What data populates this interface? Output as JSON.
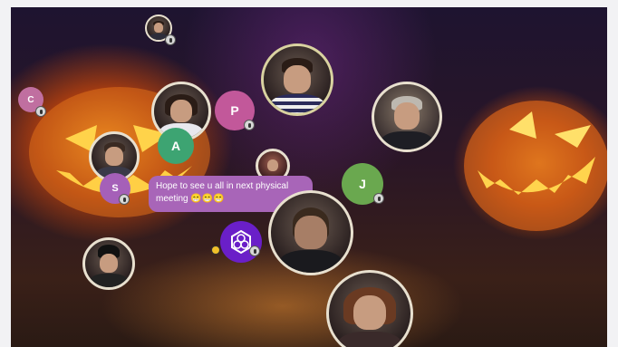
{
  "participants": [
    {
      "id": "p-top",
      "type": "video"
    },
    {
      "id": "p-c",
      "type": "letter",
      "letter": "C",
      "color": "#c06fa0"
    },
    {
      "id": "p-girl",
      "type": "video"
    },
    {
      "id": "p-p",
      "type": "letter",
      "letter": "P",
      "color": "#c2589a"
    },
    {
      "id": "p-main",
      "type": "video"
    },
    {
      "id": "p-right",
      "type": "video"
    },
    {
      "id": "p-a",
      "type": "letter",
      "letter": "A",
      "color": "#3da472"
    },
    {
      "id": "p-man",
      "type": "video"
    },
    {
      "id": "p-s",
      "type": "letter",
      "letter": "S",
      "color": "#a560b8"
    },
    {
      "id": "p-small",
      "type": "video"
    },
    {
      "id": "p-j",
      "type": "letter",
      "letter": "J",
      "color": "#6aa84f"
    },
    {
      "id": "p-beard",
      "type": "video"
    },
    {
      "id": "p-hat",
      "type": "video"
    },
    {
      "id": "p-woman",
      "type": "video"
    }
  ],
  "chat": {
    "message": "Hope to see u all in next physical meeting 😁😁😁"
  },
  "letters": {
    "c": "C",
    "p": "P",
    "a": "A",
    "s": "S",
    "j": "J"
  },
  "colors": {
    "chat_bubble": "#a865b8",
    "logo_bubble": "#6a1fc8",
    "video_border": "#e8e0cf"
  },
  "icons": {
    "mic": "mic-icon",
    "logo": "hexagon-logo-icon"
  }
}
